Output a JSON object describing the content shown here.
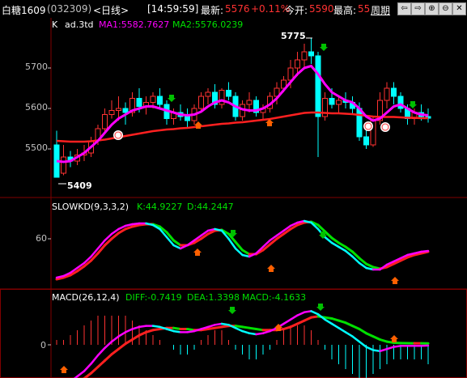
{
  "header": {
    "symbol": "白糖1609",
    "code": "(032309)",
    "period": "<日线>",
    "time": "[14:59:59]",
    "latest_label": "最新:",
    "latest_value": "5576",
    "change": "+0.11%",
    "open_label": "今开:",
    "open_value": "5590",
    "high_label": "最高:",
    "high_value": "55",
    "cycle_button": "周期",
    "nav_buttons": [
      "⇦",
      "⇨",
      "⊕",
      "⊖",
      "✕"
    ]
  },
  "colors": {
    "bg": "#000000",
    "grid": "#800000",
    "up": "#ff3232",
    "down": "#00ffff",
    "ma1": "#ff00ff",
    "ma2": "#ff2020",
    "ma_alt": "#00e000",
    "text": "#c0c0c0",
    "yellow": "#ffff00",
    "latest": "#ff3232"
  },
  "main_panel": {
    "prefix": "K",
    "title": "ad.3td",
    "ma1": "MA1:5582.7627",
    "ma2": "MA2:5576.0239",
    "y_ticks": [
      "5700",
      "5600",
      "5500"
    ],
    "high_mark": "5775",
    "low_mark": "5409"
  },
  "kd_panel": {
    "title": "SLOWKD(9,3,3,2)",
    "k": "K:44.9227",
    "d": "D:44.2447",
    "y_ticks": [
      "60"
    ]
  },
  "macd_panel": {
    "title": "MACD(26,12,4)",
    "diff": "DIFF:-0.7419",
    "dea": "DEA:1.3398",
    "macd": "MACD:-4.1633",
    "y_ticks": [
      "0"
    ]
  },
  "chart_data": {
    "type": "candlestick",
    "candles": [
      [
        5510,
        5545,
        5470,
        5430
      ],
      [
        5440,
        5510,
        5435,
        5480
      ],
      [
        5480,
        5495,
        5455,
        5470
      ],
      [
        5470,
        5500,
        5460,
        5485
      ],
      [
        5485,
        5510,
        5470,
        5490
      ],
      [
        5490,
        5530,
        5480,
        5520
      ],
      [
        5520,
        5560,
        5510,
        5550
      ],
      [
        5550,
        5600,
        5540,
        5585
      ],
      [
        5585,
        5620,
        5575,
        5595
      ],
      [
        5595,
        5630,
        5570,
        5600
      ],
      [
        5600,
        5615,
        5560,
        5590
      ],
      [
        5590,
        5640,
        5580,
        5625
      ],
      [
        5625,
        5650,
        5590,
        5605
      ],
      [
        5605,
        5630,
        5585,
        5615
      ],
      [
        5615,
        5640,
        5600,
        5630
      ],
      [
        5630,
        5650,
        5600,
        5610
      ],
      [
        5610,
        5620,
        5560,
        5575
      ],
      [
        5575,
        5600,
        5560,
        5590
      ],
      [
        5590,
        5610,
        5570,
        5580
      ],
      [
        5580,
        5600,
        5550,
        5570
      ],
      [
        5570,
        5610,
        5560,
        5600
      ],
      [
        5600,
        5640,
        5590,
        5630
      ],
      [
        5630,
        5650,
        5610,
        5640
      ],
      [
        5640,
        5660,
        5600,
        5610
      ],
      [
        5610,
        5650,
        5600,
        5645
      ],
      [
        5645,
        5665,
        5620,
        5630
      ],
      [
        5630,
        5640,
        5570,
        5580
      ],
      [
        5580,
        5620,
        5570,
        5610
      ],
      [
        5610,
        5640,
        5590,
        5620
      ],
      [
        5620,
        5630,
        5580,
        5590
      ],
      [
        5590,
        5610,
        5570,
        5600
      ],
      [
        5600,
        5640,
        5590,
        5630
      ],
      [
        5630,
        5665,
        5610,
        5650
      ],
      [
        5650,
        5680,
        5640,
        5670
      ],
      [
        5670,
        5720,
        5650,
        5700
      ],
      [
        5700,
        5740,
        5680,
        5720
      ],
      [
        5720,
        5760,
        5700,
        5740
      ],
      [
        5740,
        5775,
        5710,
        5730
      ],
      [
        5730,
        5740,
        5480,
        5580
      ],
      [
        5580,
        5640,
        5570,
        5625
      ],
      [
        5625,
        5650,
        5600,
        5610
      ],
      [
        5610,
        5630,
        5590,
        5620
      ],
      [
        5620,
        5640,
        5600,
        5615
      ],
      [
        5615,
        5630,
        5585,
        5600
      ],
      [
        5600,
        5615,
        5520,
        5530
      ],
      [
        5530,
        5560,
        5500,
        5510
      ],
      [
        5510,
        5580,
        5505,
        5570
      ],
      [
        5570,
        5640,
        5560,
        5620
      ],
      [
        5620,
        5665,
        5600,
        5650
      ],
      [
        5650,
        5665,
        5610,
        5630
      ],
      [
        5630,
        5640,
        5590,
        5600
      ],
      [
        5600,
        5610,
        5560,
        5575
      ],
      [
        5575,
        5600,
        5560,
        5590
      ],
      [
        5590,
        5610,
        5570,
        5580
      ],
      [
        5580,
        5600,
        5565,
        5576
      ]
    ],
    "ma1": [
      5470,
      5468,
      5470,
      5480,
      5490,
      5505,
      5520,
      5540,
      5560,
      5575,
      5585,
      5595,
      5600,
      5605,
      5605,
      5600,
      5595,
      5590,
      5585,
      5583,
      5585,
      5592,
      5605,
      5615,
      5620,
      5615,
      5605,
      5598,
      5595,
      5595,
      5600,
      5610,
      5625,
      5645,
      5665,
      5685,
      5700,
      5705,
      5685,
      5660,
      5640,
      5630,
      5620,
      5615,
      5600,
      5580,
      5570,
      5575,
      5590,
      5605,
      5610,
      5600,
      5590,
      5585,
      5583
    ],
    "ma2": [
      5520,
      5519,
      5518,
      5518,
      5518,
      5519,
      5521,
      5523,
      5526,
      5529,
      5532,
      5535,
      5538,
      5541,
      5544,
      5546,
      5548,
      5549,
      5551,
      5552,
      5554,
      5556,
      5558,
      5560,
      5562,
      5563,
      5565,
      5566,
      5568,
      5570,
      5572,
      5574,
      5577,
      5580,
      5583,
      5586,
      5589,
      5590,
      5590,
      5589,
      5588,
      5588,
      5587,
      5586,
      5584,
      5582,
      5580,
      5579,
      5579,
      5579,
      5578,
      5577,
      5577,
      5576,
      5576
    ],
    "kd_k": [
      12,
      14,
      18,
      24,
      30,
      38,
      48,
      58,
      66,
      72,
      76,
      78,
      79,
      79,
      77,
      72,
      62,
      52,
      48,
      52,
      58,
      64,
      70,
      72,
      70,
      60,
      48,
      40,
      38,
      42,
      50,
      58,
      64,
      70,
      76,
      80,
      82,
      80,
      72,
      62,
      55,
      50,
      45,
      38,
      30,
      24,
      22,
      22,
      28,
      32,
      36,
      40,
      42,
      44,
      45
    ],
    "kd_d": [
      10,
      12,
      15,
      20,
      26,
      33,
      42,
      52,
      60,
      67,
      72,
      75,
      77,
      78,
      78,
      75,
      68,
      58,
      52,
      52,
      55,
      60,
      66,
      70,
      71,
      66,
      56,
      46,
      41,
      41,
      46,
      53,
      60,
      66,
      72,
      77,
      80,
      81,
      77,
      69,
      61,
      55,
      50,
      44,
      36,
      29,
      25,
      23,
      25,
      29,
      33,
      37,
      40,
      42,
      44
    ],
    "macd_diff": [
      -40,
      -38,
      -35,
      -30,
      -25,
      -18,
      -10,
      -3,
      3,
      8,
      12,
      15,
      17,
      18,
      18,
      17,
      15,
      13,
      12,
      12,
      13,
      15,
      17,
      19,
      20,
      19,
      16,
      13,
      11,
      10,
      11,
      13,
      16,
      20,
      24,
      28,
      31,
      32,
      29,
      24,
      20,
      16,
      12,
      8,
      3,
      -2,
      -5,
      -6,
      -4,
      -2,
      -1,
      -1,
      -1,
      -1,
      -0.7
    ],
    "macd_dea": [
      -42,
      -41,
      -39,
      -36,
      -32,
      -27,
      -21,
      -15,
      -9,
      -4,
      1,
      5,
      9,
      12,
      14,
      15,
      16,
      16,
      15,
      15,
      14,
      14,
      15,
      16,
      17,
      18,
      18,
      17,
      16,
      15,
      14,
      14,
      14,
      15,
      17,
      20,
      23,
      26,
      27,
      26,
      25,
      23,
      21,
      18,
      15,
      11,
      8,
      5,
      3,
      2,
      1.6,
      1.5,
      1.4,
      1.4,
      1.34
    ],
    "macd_bar": [
      1,
      1,
      2,
      3,
      4,
      5,
      6,
      6,
      6,
      6,
      6,
      5,
      4,
      3,
      2,
      1,
      0,
      -1,
      -2,
      -2,
      -1,
      1,
      2,
      3,
      3,
      1,
      -1,
      -2,
      -3,
      -3,
      -2,
      -1,
      1,
      3,
      4,
      4,
      4,
      3,
      1,
      -1,
      -3,
      -4,
      -5,
      -6,
      -7,
      -7,
      -6,
      -5,
      -4,
      -3,
      -3,
      -3,
      -3,
      -3,
      -4
    ]
  }
}
